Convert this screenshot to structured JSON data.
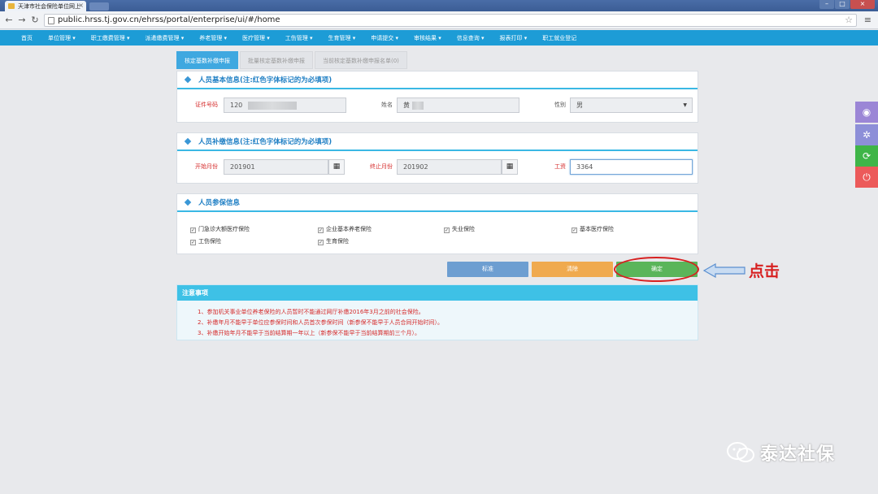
{
  "browser": {
    "tab_title": "天津市社会保险单位网上",
    "url": "public.hrss.tj.gov.cn/ehrss/portal/enterprise/ui/#/home"
  },
  "nav": {
    "items": [
      "首页",
      "单位管理 ▾",
      "职工缴费管理 ▾",
      "派遣缴费管理 ▾",
      "养老管理 ▾",
      "医疗管理 ▾",
      "工伤管理 ▾",
      "生育管理 ▾",
      "申请提交 ▾",
      "审核结果 ▾",
      "信息查询 ▾",
      "报表打印 ▾",
      "职工就业登记"
    ]
  },
  "subtabs": [
    "核定基数补缴申报",
    "批量核定基数补缴申报",
    "当前核定基数补缴申报名单(0)"
  ],
  "basic_info": {
    "title": "人员基本信息(注:红色字体标记的为必填项)",
    "id_label": "证件号码",
    "id_value": "120",
    "name_label": "姓名",
    "name_value": "黄",
    "gender_label": "性别",
    "gender_value": "男"
  },
  "payment_info": {
    "title": "人员补缴信息(注:红色字体标记的为必填项)",
    "start_label": "开始月份",
    "start_value": "201901",
    "end_label": "终止月份",
    "end_value": "201902",
    "wage_label": "工资",
    "wage_value": "3364"
  },
  "insurance_info": {
    "title": "人员参保信息",
    "items": [
      "门急诊大额医疗保险",
      "企业基本养老保险",
      "失业保险",
      "基本医疗保险",
      "工伤保险",
      "生育保险"
    ]
  },
  "buttons": {
    "reset": "标准",
    "clear": "清除",
    "ok": "确定"
  },
  "annotation": {
    "click_text": "点击"
  },
  "notice": {
    "title": "注意事项",
    "lines": [
      "1、参加机关事业单位养老保险的人员暂时不能通过网厅补缴2016年3月之前的社会保险。",
      "2、补缴年月不能早于单位应参保时间和人员首次参保时间（新参保不能早于人员合同开始时间）。",
      "3、补缴开始年月不能早于当前结算期一年以上（新参保不能早于当前结算期前三个月）。"
    ]
  },
  "watermark": {
    "text": "泰达社保"
  },
  "colors": {
    "nav_bg": "#1d9cd6",
    "accent": "#3ab8e4",
    "required": "#d52b2b",
    "ok_button": "#5ab55a"
  }
}
